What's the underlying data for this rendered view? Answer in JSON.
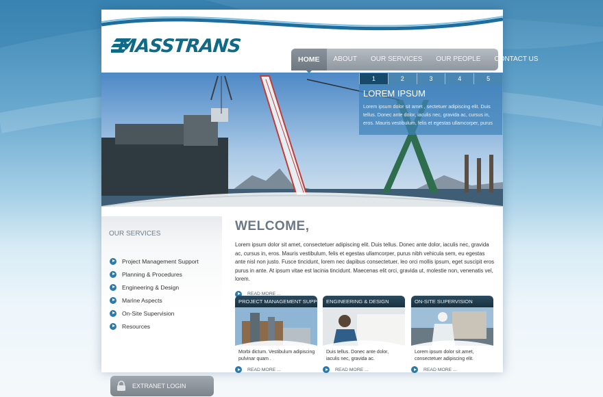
{
  "brand": {
    "logo_text": "MASSTRANS"
  },
  "nav": {
    "items": [
      {
        "label": "HOME",
        "active": true
      },
      {
        "label": "ABOUT",
        "active": false
      },
      {
        "label": "OUR SERVICES",
        "active": false
      },
      {
        "label": "OUR PEOPLE",
        "active": false
      },
      {
        "label": "CONTACT US",
        "active": false
      }
    ]
  },
  "hero": {
    "tabs": [
      "1",
      "2",
      "3",
      "4",
      "5"
    ],
    "active_tab": "1",
    "title": "LOREM IPSUM",
    "text": "Lorem ipsum dolor sit amet , sectetuer adipiscing elit. Duis tellus. Donec ante dolor, iaculis nec, gravida ac, cursus in, eros. Mauris vestibulum, felis et egestas ullamcorper, purus"
  },
  "sidebar": {
    "title": "OUR SERVICES",
    "items": [
      {
        "label": "Project Management Support"
      },
      {
        "label": "Planning & Procedures"
      },
      {
        "label": "Engineering & Design"
      },
      {
        "label": "Marine Aspects"
      },
      {
        "label": "On-Site Supervision"
      },
      {
        "label": "Resources"
      }
    ]
  },
  "main": {
    "heading": "WELCOME,",
    "intro": "Lorem ipsum dolor sit amet, consectetuer adipiscing elit. Duis tellus. Donec ante dolor, iaculis nec, gravida ac, cursus in, eros. Mauris vestibulum, felis et egestas ullamcorper, purus nibh vehicula sem, eu egestas ante nisl non justo. Fusce tincidunt, lorem nec dapibus consectetuer, leo orci mollis ipsum, eget suscipit eros purus in ante. At ipsum vitae est lacinia tincidunt. Maecenas elit orci, gravida ut, molestie non, venenatis vel, lorem.",
    "read_more": "READ MORE ..."
  },
  "cards": [
    {
      "title": "PROJECT MANAGEMENT SUPPORT",
      "text": "Morbi dictum. Vestibulum adipiscing pulvinar quam .",
      "read_more": "READ MORE ..."
    },
    {
      "title": "ENGINEERING & DESIGN",
      "text": "Duis tellus. Donec ante dolor, iaculis nec, gravida ac.",
      "read_more": "READ MORE ..."
    },
    {
      "title": "ON-SITE SUPERVISION",
      "text": "Lorem ipsum dolor sit amet, consectetuer adipiscing elit.",
      "read_more": "READ MORE ..."
    }
  ],
  "login": {
    "label": "EXTRANET LOGIN"
  },
  "colors": {
    "accent": "#0e6a86",
    "nav": "#8f979f",
    "hero_box": "#4082b9",
    "dark_tab": "#17496b"
  }
}
